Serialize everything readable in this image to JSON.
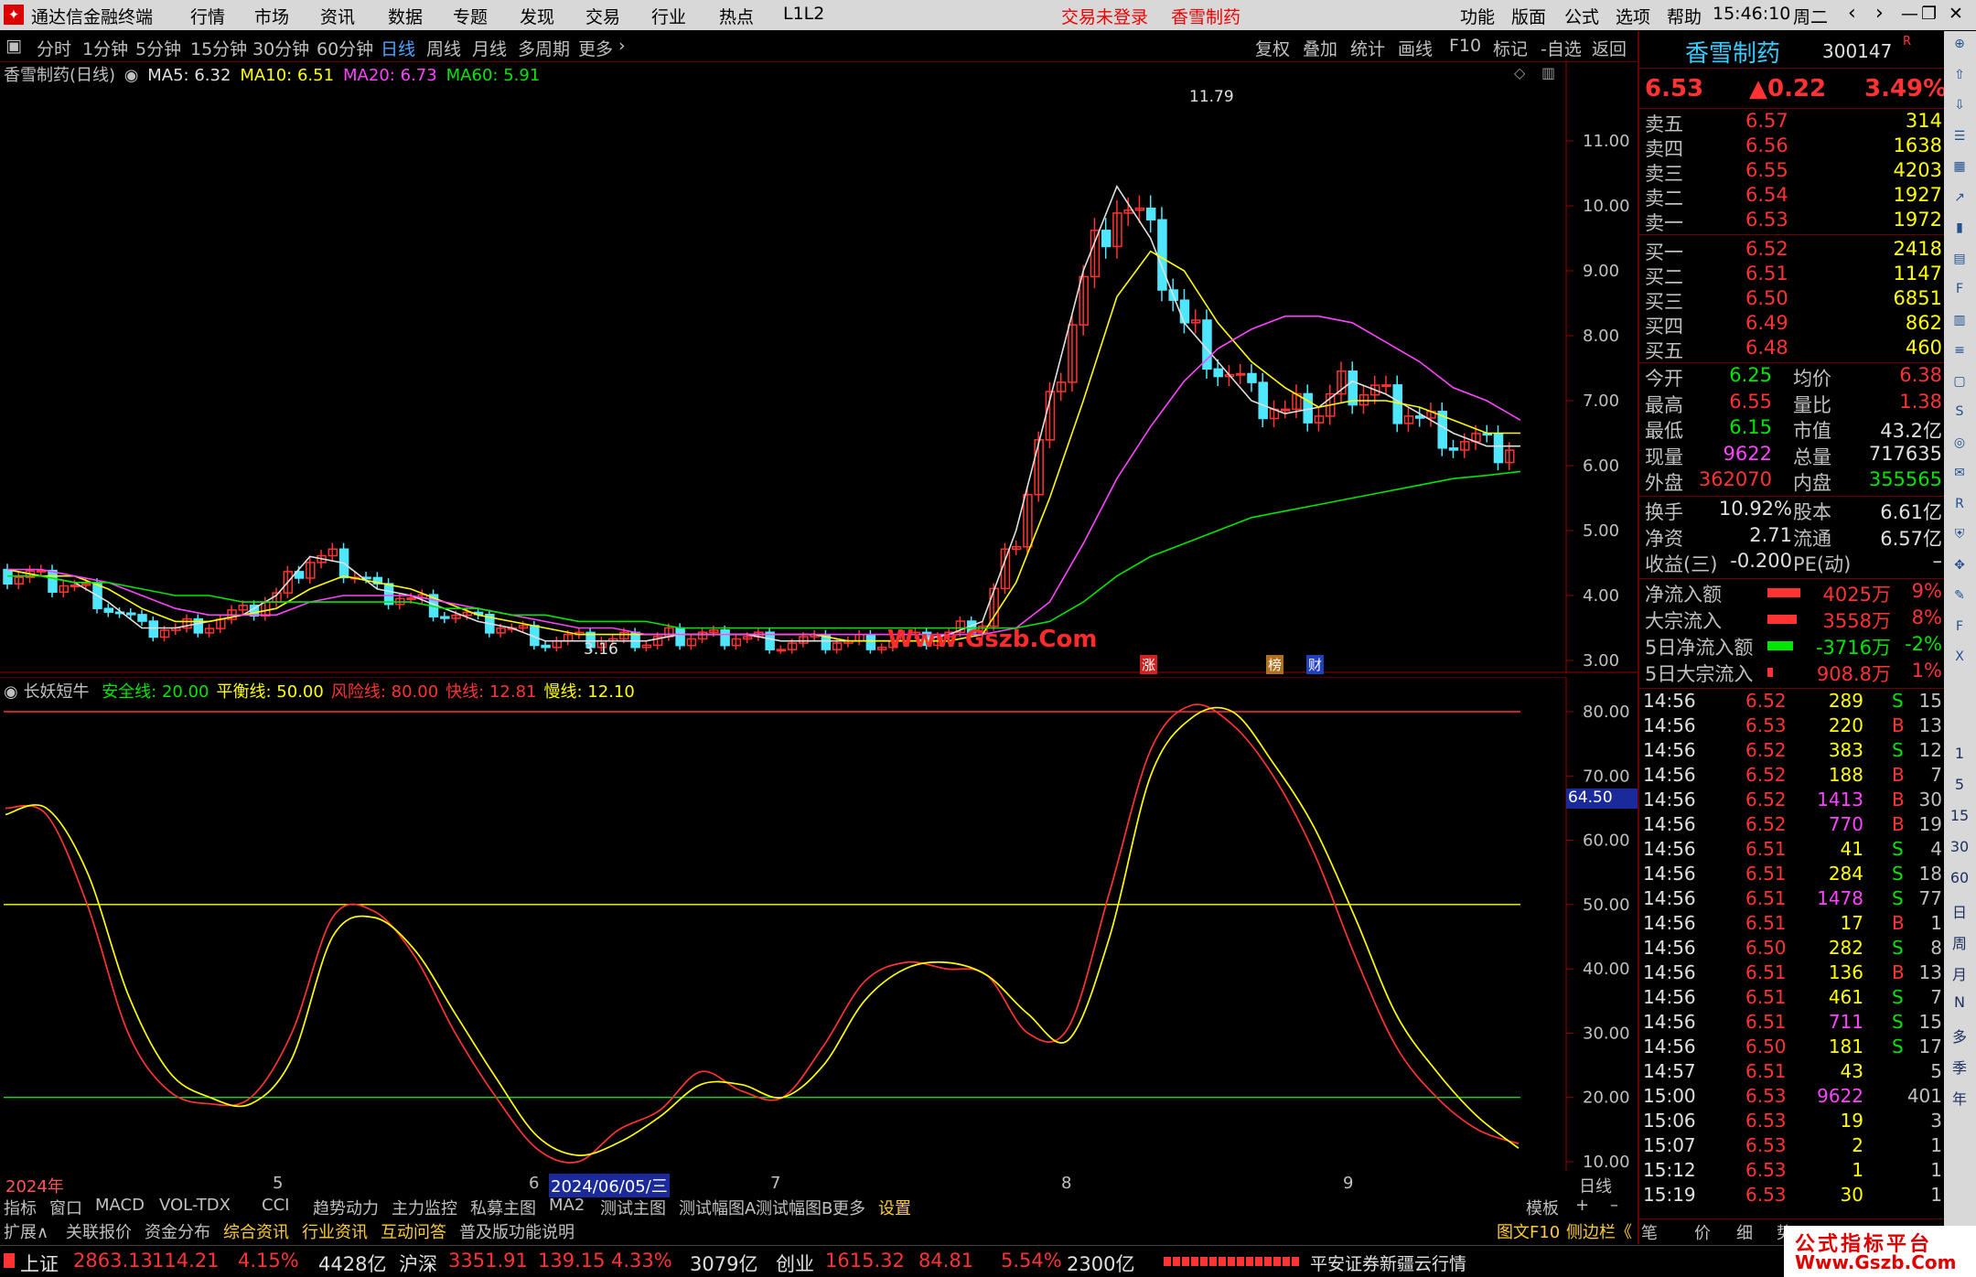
{
  "app": {
    "title": "通达信金融终端",
    "login_status": "交易未登录",
    "stock_short": "香雪制药",
    "clock": "15:46:10",
    "weekday": "周二"
  },
  "top_menu": [
    "行情",
    "市场",
    "资讯",
    "数据",
    "专题",
    "发现",
    "交易",
    "行业",
    "热点",
    "L1L2"
  ],
  "right_menu": [
    "功能",
    "版面",
    "公式",
    "选项",
    "帮助"
  ],
  "periods": [
    "分时",
    "1分钟",
    "5分钟",
    "15分钟",
    "30分钟",
    "60分钟",
    "日线",
    "周线",
    "月线",
    "多周期",
    "更多"
  ],
  "chart_buttons": [
    "复权",
    "叠加",
    "统计",
    "画线",
    "F10",
    "标记",
    "-自选",
    "返回"
  ],
  "main_chart": {
    "stock_label": "香雪制药(日线)",
    "ma": [
      {
        "name": "MA5",
        "value": "6.32",
        "color": "#e0e0e0"
      },
      {
        "name": "MA10",
        "value": "6.51",
        "color": "#ffff00"
      },
      {
        "name": "MA20",
        "value": "6.73",
        "color": "#ff44ff"
      },
      {
        "name": "MA60",
        "value": "5.91",
        "color": "#00e600"
      }
    ],
    "high_label": "11.79",
    "low_label": "3.16",
    "watermark": "Www.Gszb.Com",
    "markers": [
      "涨",
      "榜",
      "财"
    ]
  },
  "indicator": {
    "name": "长妖短牛",
    "params": [
      {
        "name": "安全线",
        "value": "20.00",
        "color": "#00e600"
      },
      {
        "name": "平衡线",
        "value": "50.00",
        "color": "#ffff00"
      },
      {
        "name": "风险线",
        "value": "80.00",
        "color": "#ff3333"
      },
      {
        "name": "快线",
        "value": "12.81",
        "color": "#ff3333"
      },
      {
        "name": "慢线",
        "value": "12.10",
        "color": "#ffff00"
      }
    ],
    "cursor_value": "64.50"
  },
  "chart_data": [
    {
      "type": "candlestick",
      "title": "香雪制药(日线)",
      "ylim": [
        3.0,
        11.8
      ],
      "y_ticks": [
        "11.00",
        "10.00",
        "9.00",
        "8.00",
        "7.00",
        "6.00",
        "5.00",
        "4.00",
        "3.00"
      ],
      "x_ticks": [
        "2024年",
        "5",
        "6",
        "2024/06/05/三",
        "7",
        "8",
        "9",
        "日线"
      ],
      "series": [
        {
          "name": "MA5",
          "values": [
            4.4,
            4.3,
            4.2,
            3.9,
            3.5,
            3.5,
            3.6,
            3.7,
            4.0,
            4.6,
            4.5,
            4.1,
            4.0,
            3.8,
            3.6,
            3.5,
            3.3,
            3.3,
            3.3,
            3.3,
            3.4,
            3.4,
            3.4,
            3.3,
            3.3,
            3.3,
            3.3,
            3.3,
            3.4,
            3.6,
            5.0,
            7.0,
            9.0,
            10.3,
            9.5,
            8.2,
            7.6,
            7.0,
            6.8,
            6.9,
            7.3,
            7.1,
            6.8,
            6.5,
            6.3,
            6.3
          ]
        },
        {
          "name": "MA10",
          "values": [
            4.4,
            4.3,
            4.3,
            4.1,
            3.8,
            3.6,
            3.6,
            3.7,
            3.8,
            4.1,
            4.3,
            4.2,
            4.1,
            3.9,
            3.7,
            3.6,
            3.5,
            3.4,
            3.4,
            3.4,
            3.4,
            3.4,
            3.4,
            3.4,
            3.4,
            3.3,
            3.3,
            3.3,
            3.3,
            3.4,
            4.2,
            5.5,
            7.0,
            8.6,
            9.3,
            9.0,
            8.2,
            7.6,
            7.2,
            6.9,
            7.0,
            7.0,
            6.9,
            6.7,
            6.5,
            6.5
          ]
        },
        {
          "name": "MA20",
          "values": [
            4.4,
            4.4,
            4.3,
            4.2,
            4.0,
            3.8,
            3.7,
            3.7,
            3.7,
            3.9,
            4.0,
            4.0,
            4.0,
            3.9,
            3.8,
            3.7,
            3.6,
            3.5,
            3.5,
            3.4,
            3.4,
            3.4,
            3.4,
            3.4,
            3.4,
            3.4,
            3.4,
            3.4,
            3.4,
            3.4,
            3.5,
            3.9,
            4.8,
            5.8,
            6.6,
            7.3,
            7.8,
            8.1,
            8.3,
            8.3,
            8.2,
            7.9,
            7.6,
            7.2,
            7.0,
            6.7
          ]
        },
        {
          "name": "MA60",
          "values": [
            4.3,
            4.3,
            4.2,
            4.2,
            4.1,
            4.0,
            4.0,
            3.9,
            3.9,
            3.9,
            3.9,
            3.9,
            3.9,
            3.8,
            3.8,
            3.7,
            3.7,
            3.6,
            3.6,
            3.6,
            3.5,
            3.5,
            3.5,
            3.5,
            3.5,
            3.5,
            3.5,
            3.5,
            3.5,
            3.5,
            3.5,
            3.6,
            3.9,
            4.3,
            4.6,
            4.8,
            5.0,
            5.2,
            5.3,
            5.4,
            5.5,
            5.6,
            5.7,
            5.8,
            5.85,
            5.91
          ]
        }
      ]
    },
    {
      "type": "line",
      "title": "长妖短牛",
      "ylim": [
        10,
        80
      ],
      "y_ticks": [
        "80.00",
        "70.00",
        "60.00",
        "50.00",
        "40.00",
        "30.00",
        "20.00",
        "10.00"
      ],
      "series": [
        {
          "name": "快线",
          "values": [
            65,
            64,
            50,
            30,
            21,
            19,
            20,
            30,
            48,
            49,
            42,
            30,
            20,
            12,
            10,
            15,
            18,
            24,
            21,
            20,
            28,
            38,
            41,
            40,
            39,
            30,
            31,
            52,
            74,
            81,
            78,
            70,
            58,
            42,
            28,
            20,
            15,
            12.81
          ]
        },
        {
          "name": "慢线",
          "values": [
            64,
            65,
            55,
            36,
            24,
            20,
            19,
            26,
            45,
            48,
            43,
            33,
            23,
            14,
            11,
            13,
            17,
            22,
            22,
            20,
            25,
            35,
            40,
            41,
            39,
            33,
            29,
            45,
            70,
            79,
            80,
            72,
            62,
            48,
            33,
            24,
            17,
            12.1
          ]
        },
        {
          "name": "安全线",
          "values": [
            20.0
          ]
        },
        {
          "name": "平衡线",
          "values": [
            50.0
          ]
        },
        {
          "name": "风险线",
          "values": [
            80.0
          ]
        }
      ]
    }
  ],
  "quote": {
    "name": "香雪制药",
    "code": "300147",
    "price": "6.53",
    "change": "▲0.22",
    "pct": "3.49%",
    "asks": [
      {
        "label": "卖五",
        "price": "6.57",
        "vol": "314"
      },
      {
        "label": "卖四",
        "price": "6.56",
        "vol": "1638"
      },
      {
        "label": "卖三",
        "price": "6.55",
        "vol": "4203"
      },
      {
        "label": "卖二",
        "price": "6.54",
        "vol": "1927"
      },
      {
        "label": "卖一",
        "price": "6.53",
        "vol": "1972"
      }
    ],
    "bids": [
      {
        "label": "买一",
        "price": "6.52",
        "vol": "2418"
      },
      {
        "label": "买二",
        "price": "6.51",
        "vol": "1147"
      },
      {
        "label": "买三",
        "price": "6.50",
        "vol": "6851"
      },
      {
        "label": "买四",
        "price": "6.49",
        "vol": "862"
      },
      {
        "label": "买五",
        "price": "6.48",
        "vol": "460"
      }
    ],
    "stats": [
      {
        "l1": "今开",
        "v1": "6.25",
        "c1": "grn",
        "l2": "均价",
        "v2": "6.38",
        "c2": "red"
      },
      {
        "l1": "最高",
        "v1": "6.55",
        "c1": "red",
        "l2": "量比",
        "v2": "1.38",
        "c2": "red"
      },
      {
        "l1": "最低",
        "v1": "6.15",
        "c1": "grn",
        "l2": "市值",
        "v2": "43.2亿",
        "c2": "wht"
      },
      {
        "l1": "现量",
        "v1": "9622",
        "c1": "mag",
        "l2": "总量",
        "v2": "717635",
        "c2": "wht"
      },
      {
        "l1": "外盘",
        "v1": "362070",
        "c1": "red",
        "l2": "内盘",
        "v2": "355565",
        "c2": "grn"
      }
    ],
    "stats2": [
      {
        "l1": "换手",
        "v1": "10.92%",
        "l2": "股本",
        "v2": "6.61亿"
      },
      {
        "l1": "净资",
        "v1": "2.71",
        "l2": "流通",
        "v2": "6.57亿"
      },
      {
        "l1": "收益(三)",
        "v1": "-0.200",
        "l2": "PE(动)",
        "v2": "–"
      }
    ],
    "flows": [
      {
        "label": "净流入额",
        "value": "4025万",
        "pct": "9%",
        "bar": 0.9,
        "color": "#ff3333"
      },
      {
        "label": "大宗流入",
        "value": "3558万",
        "pct": "8%",
        "bar": 0.8,
        "color": "#ff3333"
      },
      {
        "label": "5日净流入额",
        "value": "-3716万",
        "pct": "-2%",
        "bar": 0.7,
        "color": "#00e600"
      },
      {
        "label": "5日大宗流入",
        "value": "908.8万",
        "pct": "1%",
        "bar": 0.15,
        "color": "#ff3333"
      }
    ],
    "ticks": [
      {
        "t": "14:56",
        "p": "6.52",
        "v": "289",
        "s": "S",
        "n": "15"
      },
      {
        "t": "14:56",
        "p": "6.53",
        "v": "220",
        "s": "B",
        "n": "13"
      },
      {
        "t": "14:56",
        "p": "6.52",
        "v": "383",
        "s": "S",
        "n": "12"
      },
      {
        "t": "14:56",
        "p": "6.52",
        "v": "188",
        "s": "B",
        "n": "7"
      },
      {
        "t": "14:56",
        "p": "6.52",
        "v": "1413",
        "s": "B",
        "n": "30"
      },
      {
        "t": "14:56",
        "p": "6.52",
        "v": "770",
        "s": "B",
        "n": "19"
      },
      {
        "t": "14:56",
        "p": "6.51",
        "v": "41",
        "s": "S",
        "n": "4"
      },
      {
        "t": "14:56",
        "p": "6.51",
        "v": "284",
        "s": "S",
        "n": "18"
      },
      {
        "t": "14:56",
        "p": "6.51",
        "v": "1478",
        "s": "S",
        "n": "77"
      },
      {
        "t": "14:56",
        "p": "6.51",
        "v": "17",
        "s": "B",
        "n": "1"
      },
      {
        "t": "14:56",
        "p": "6.50",
        "v": "282",
        "s": "S",
        "n": "8"
      },
      {
        "t": "14:56",
        "p": "6.51",
        "v": "136",
        "s": "B",
        "n": "13"
      },
      {
        "t": "14:56",
        "p": "6.51",
        "v": "461",
        "s": "S",
        "n": "7"
      },
      {
        "t": "14:56",
        "p": "6.51",
        "v": "711",
        "s": "S",
        "n": "15"
      },
      {
        "t": "14:56",
        "p": "6.50",
        "v": "181",
        "s": "S",
        "n": "17"
      },
      {
        "t": "14:57",
        "p": "6.51",
        "v": "43",
        "s": "",
        "n": "5"
      },
      {
        "t": "15:00",
        "p": "6.53",
        "v": "9622",
        "s": "",
        "n": "401"
      },
      {
        "t": "15:06",
        "p": "6.53",
        "v": "19",
        "s": "",
        "n": "3"
      },
      {
        "t": "15:07",
        "p": "6.53",
        "v": "2",
        "s": "",
        "n": "1"
      },
      {
        "t": "15:12",
        "p": "6.53",
        "v": "1",
        "s": "",
        "n": "1"
      },
      {
        "t": "15:19",
        "p": "6.53",
        "v": "30",
        "s": "",
        "n": "1"
      }
    ],
    "bottom_tabs": [
      "图文F10",
      "侧边栏《",
      "笔",
      "价",
      "细",
      "势"
    ]
  },
  "indicator_tabs": [
    "指标",
    "窗口",
    "MACD",
    "VOL-TDX",
    "CCI",
    "趋势动力",
    "主力监控",
    "私募主图",
    "MA2",
    "测试主图",
    "测试幅图A",
    "测试幅图B",
    "更多",
    "设置"
  ],
  "indicator_tabs_right": [
    "模板",
    "+",
    "–"
  ],
  "info_tabs": [
    "扩展∧",
    "关联报价",
    "资金分布",
    "综合资讯",
    "行业资讯",
    "互动问答",
    "普及版功能说明"
  ],
  "index_bar": [
    {
      "name": "上证",
      "value": "2863.13",
      "chg": "114.21",
      "pct": "4.15%",
      "amt": "4428亿"
    },
    {
      "name": "沪深",
      "value": "3351.91",
      "chg": "139.15",
      "pct": "4.33%",
      "amt": "3079亿"
    },
    {
      "name": "创业",
      "value": "1615.32",
      "chg": "84.81",
      "pct": "5.54%",
      "amt": "2300亿"
    }
  ],
  "broker": "平安证券新疆云行情",
  "site_badge": {
    "line1": "公式指标平台",
    "line2": "Www.Gszb.Com"
  }
}
